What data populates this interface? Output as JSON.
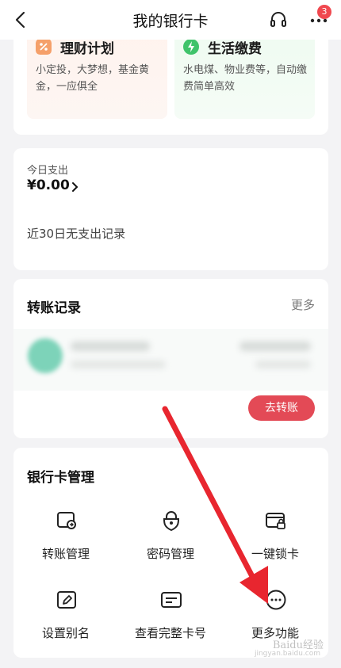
{
  "nav": {
    "title": "我的银行卡",
    "badge_count": "3"
  },
  "features": [
    {
      "title": "理财计划",
      "desc": "小定投，大梦想，基金黄金，一应俱全",
      "accent": "#f5a06a"
    },
    {
      "title": "生活缴费",
      "desc": "水电煤、物业费等，自动缴费简单高效",
      "accent": "#3fc36a"
    }
  ],
  "spend": {
    "label": "今日支出",
    "amount": "¥0.00",
    "no_record": "近30日无支出记录"
  },
  "transfer": {
    "title": "转账记录",
    "more": "更多",
    "go_button": "去转账"
  },
  "management": {
    "title": "银行卡管理",
    "items": [
      {
        "label": "转账管理",
        "icon": "transfer-manage-icon"
      },
      {
        "label": "密码管理",
        "icon": "lock-icon"
      },
      {
        "label": "一键锁卡",
        "icon": "card-lock-icon"
      },
      {
        "label": "设置别名",
        "icon": "edit-icon"
      },
      {
        "label": "查看完整卡号",
        "icon": "card-number-icon"
      },
      {
        "label": "更多功能",
        "icon": "more-circle-icon"
      }
    ]
  },
  "watermark": "Baidu经验",
  "watermark_url": "jingyan.baidu.com",
  "colors": {
    "primary_red": "#e34a56",
    "badge_red": "#f0484f",
    "arrow_red": "#e8262f"
  }
}
